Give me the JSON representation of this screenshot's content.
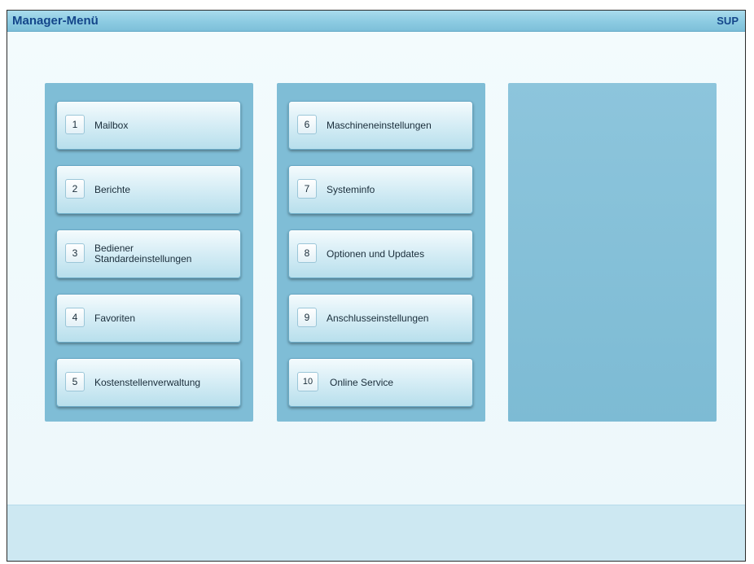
{
  "header": {
    "title": "Manager-Menü",
    "role": "SUP"
  },
  "menu": {
    "left": [
      {
        "num": "1",
        "label": "Mailbox"
      },
      {
        "num": "2",
        "label": "Berichte"
      },
      {
        "num": "3",
        "label": "Bediener\nStandardeinstellungen"
      },
      {
        "num": "4",
        "label": "Favoriten"
      },
      {
        "num": "5",
        "label": "Kostenstellenverwaltung"
      }
    ],
    "middle": [
      {
        "num": "6",
        "label": "Maschineneinstellungen"
      },
      {
        "num": "7",
        "label": "Systeminfo"
      },
      {
        "num": "8",
        "label": "Optionen und Updates"
      },
      {
        "num": "9",
        "label": "Anschlusseinstellungen"
      },
      {
        "num": "10",
        "label": "Online Service"
      }
    ]
  },
  "colors": {
    "title_text": "#14468a",
    "panel": "#7fbdd6",
    "header_bar": "#8ccbe2"
  }
}
